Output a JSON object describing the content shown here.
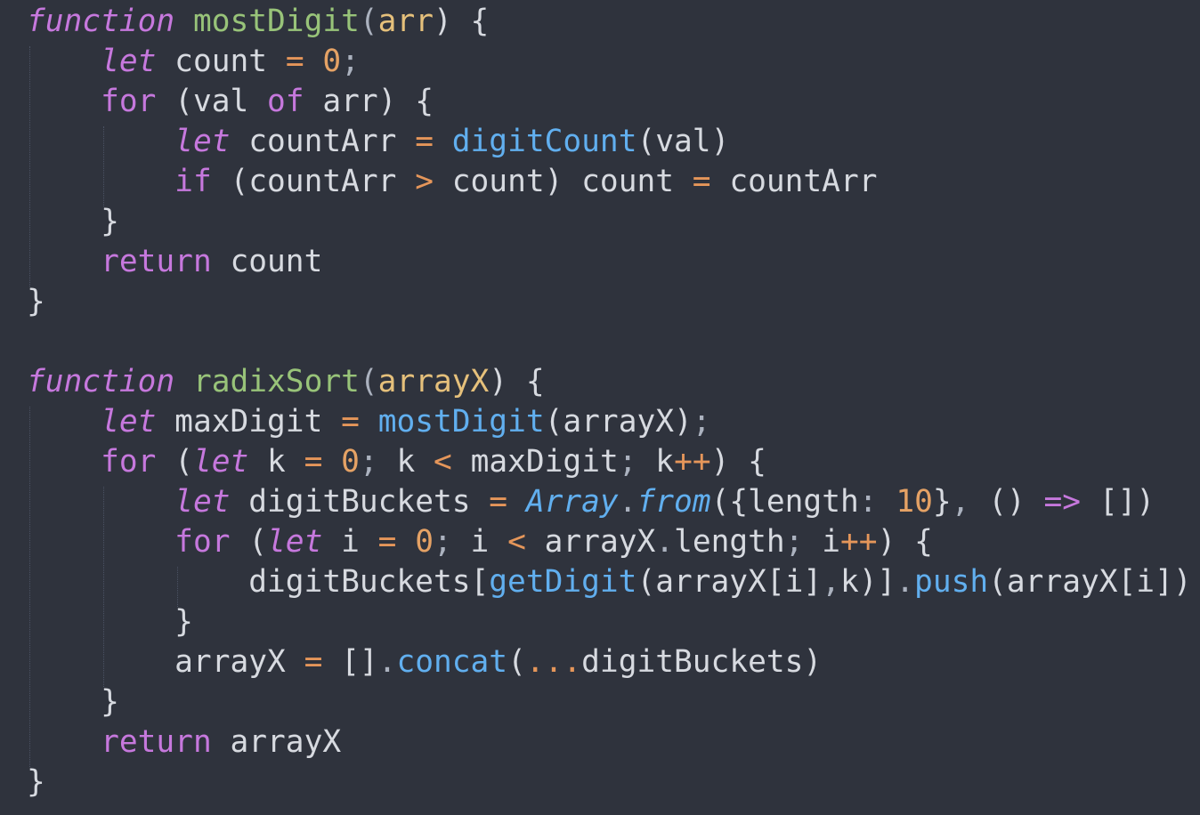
{
  "code": {
    "lines": [
      [
        {
          "t": "function",
          "c": "ki"
        },
        {
          "t": " ",
          "c": "v"
        },
        {
          "t": "mostDigit",
          "c": "fn"
        },
        {
          "t": "(",
          "c": "pu"
        },
        {
          "t": "arr",
          "c": "p"
        },
        {
          "t": ") {",
          "c": "v"
        }
      ],
      [
        {
          "t": "    ",
          "c": "v"
        },
        {
          "t": "let",
          "c": "ki"
        },
        {
          "t": " count ",
          "c": "v"
        },
        {
          "t": "=",
          "c": "op"
        },
        {
          "t": " ",
          "c": "v"
        },
        {
          "t": "0",
          "c": "n"
        },
        {
          "t": ";",
          "c": "pu"
        }
      ],
      [
        {
          "t": "    ",
          "c": "v"
        },
        {
          "t": "for",
          "c": "k"
        },
        {
          "t": " (val ",
          "c": "v"
        },
        {
          "t": "of",
          "c": "k"
        },
        {
          "t": " arr) {",
          "c": "v"
        }
      ],
      [
        {
          "t": "        ",
          "c": "v"
        },
        {
          "t": "let",
          "c": "ki"
        },
        {
          "t": " countArr ",
          "c": "v"
        },
        {
          "t": "=",
          "c": "op"
        },
        {
          "t": " ",
          "c": "v"
        },
        {
          "t": "digitCount",
          "c": "fc"
        },
        {
          "t": "(val)",
          "c": "v"
        }
      ],
      [
        {
          "t": "        ",
          "c": "v"
        },
        {
          "t": "if",
          "c": "k"
        },
        {
          "t": " (countArr ",
          "c": "v"
        },
        {
          "t": ">",
          "c": "op"
        },
        {
          "t": " count) count ",
          "c": "v"
        },
        {
          "t": "=",
          "c": "op"
        },
        {
          "t": " countArr",
          "c": "v"
        }
      ],
      [
        {
          "t": "    }",
          "c": "v"
        }
      ],
      [
        {
          "t": "    ",
          "c": "v"
        },
        {
          "t": "return",
          "c": "k"
        },
        {
          "t": " count",
          "c": "v"
        }
      ],
      [
        {
          "t": "}",
          "c": "v"
        }
      ],
      [],
      [
        {
          "t": "function",
          "c": "ki"
        },
        {
          "t": " ",
          "c": "v"
        },
        {
          "t": "radixSort",
          "c": "fn"
        },
        {
          "t": "(",
          "c": "pu"
        },
        {
          "t": "arrayX",
          "c": "p"
        },
        {
          "t": ") {",
          "c": "v"
        }
      ],
      [
        {
          "t": "    ",
          "c": "v"
        },
        {
          "t": "let",
          "c": "ki"
        },
        {
          "t": " maxDigit ",
          "c": "v"
        },
        {
          "t": "=",
          "c": "op"
        },
        {
          "t": " ",
          "c": "v"
        },
        {
          "t": "mostDigit",
          "c": "fc"
        },
        {
          "t": "(arrayX)",
          "c": "v"
        },
        {
          "t": ";",
          "c": "pu"
        }
      ],
      [
        {
          "t": "    ",
          "c": "v"
        },
        {
          "t": "for",
          "c": "k"
        },
        {
          "t": " (",
          "c": "v"
        },
        {
          "t": "let",
          "c": "ki"
        },
        {
          "t": " k ",
          "c": "v"
        },
        {
          "t": "=",
          "c": "op"
        },
        {
          "t": " ",
          "c": "v"
        },
        {
          "t": "0",
          "c": "n"
        },
        {
          "t": ";",
          "c": "pu"
        },
        {
          "t": " k ",
          "c": "v"
        },
        {
          "t": "<",
          "c": "op"
        },
        {
          "t": " maxDigit",
          "c": "v"
        },
        {
          "t": ";",
          "c": "pu"
        },
        {
          "t": " k",
          "c": "v"
        },
        {
          "t": "++",
          "c": "op"
        },
        {
          "t": ") {",
          "c": "v"
        }
      ],
      [
        {
          "t": "        ",
          "c": "v"
        },
        {
          "t": "let",
          "c": "ki"
        },
        {
          "t": " digitBuckets ",
          "c": "v"
        },
        {
          "t": "=",
          "c": "op"
        },
        {
          "t": " ",
          "c": "v"
        },
        {
          "t": "Array",
          "c": "cl"
        },
        {
          "t": ".",
          "c": "pu"
        },
        {
          "t": "from",
          "c": "cl"
        },
        {
          "t": "({length",
          "c": "v"
        },
        {
          "t": ":",
          "c": "pu"
        },
        {
          "t": " ",
          "c": "v"
        },
        {
          "t": "10",
          "c": "n"
        },
        {
          "t": "}",
          "c": "v"
        },
        {
          "t": ",",
          "c": "pu"
        },
        {
          "t": " () ",
          "c": "v"
        },
        {
          "t": "=>",
          "c": "k"
        },
        {
          "t": " [])",
          "c": "v"
        }
      ],
      [
        {
          "t": "        ",
          "c": "v"
        },
        {
          "t": "for",
          "c": "k"
        },
        {
          "t": " (",
          "c": "v"
        },
        {
          "t": "let",
          "c": "ki"
        },
        {
          "t": " i ",
          "c": "v"
        },
        {
          "t": "=",
          "c": "op"
        },
        {
          "t": " ",
          "c": "v"
        },
        {
          "t": "0",
          "c": "n"
        },
        {
          "t": ";",
          "c": "pu"
        },
        {
          "t": " i ",
          "c": "v"
        },
        {
          "t": "<",
          "c": "op"
        },
        {
          "t": " arrayX",
          "c": "v"
        },
        {
          "t": ".",
          "c": "pu"
        },
        {
          "t": "length",
          "c": "v"
        },
        {
          "t": ";",
          "c": "pu"
        },
        {
          "t": " i",
          "c": "v"
        },
        {
          "t": "++",
          "c": "op"
        },
        {
          "t": ") {",
          "c": "v"
        }
      ],
      [
        {
          "t": "            digitBuckets[",
          "c": "v"
        },
        {
          "t": "getDigit",
          "c": "fc"
        },
        {
          "t": "(arrayX[i]",
          "c": "v"
        },
        {
          "t": ",",
          "c": "pu"
        },
        {
          "t": "k)]",
          "c": "v"
        },
        {
          "t": ".",
          "c": "pu"
        },
        {
          "t": "push",
          "c": "fc"
        },
        {
          "t": "(arrayX[i])",
          "c": "v"
        }
      ],
      [
        {
          "t": "        }",
          "c": "v"
        }
      ],
      [
        {
          "t": "        arrayX ",
          "c": "v"
        },
        {
          "t": "=",
          "c": "op"
        },
        {
          "t": " []",
          "c": "v"
        },
        {
          "t": ".",
          "c": "pu"
        },
        {
          "t": "concat",
          "c": "fc"
        },
        {
          "t": "(",
          "c": "v"
        },
        {
          "t": "...",
          "c": "op"
        },
        {
          "t": "digitBuckets)",
          "c": "v"
        }
      ],
      [
        {
          "t": "    }",
          "c": "v"
        }
      ],
      [
        {
          "t": "    ",
          "c": "v"
        },
        {
          "t": "return",
          "c": "k"
        },
        {
          "t": " arrayX",
          "c": "v"
        }
      ],
      [
        {
          "t": "}",
          "c": "v"
        }
      ]
    ]
  }
}
